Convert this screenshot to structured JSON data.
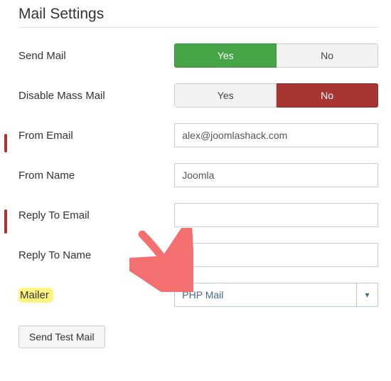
{
  "heading": "Mail Settings",
  "fields": {
    "send_mail": {
      "label": "Send Mail",
      "yes": "Yes",
      "no": "No"
    },
    "disable_mass": {
      "label": "Disable Mass Mail",
      "yes": "Yes",
      "no": "No"
    },
    "from_email": {
      "label": "From Email",
      "value": "alex@joomlashack.com"
    },
    "from_name": {
      "label": "From Name",
      "value": "Joomla"
    },
    "reply_email": {
      "label": "Reply To Email",
      "value": ""
    },
    "reply_name": {
      "label": "Reply To Name",
      "value": ""
    },
    "mailer": {
      "label": "Mailer",
      "value": "PHP Mail"
    }
  },
  "buttons": {
    "send_test": "Send Test Mail"
  },
  "colors": {
    "green": "#46a546",
    "red": "#a83532",
    "highlight": "#fff480"
  }
}
